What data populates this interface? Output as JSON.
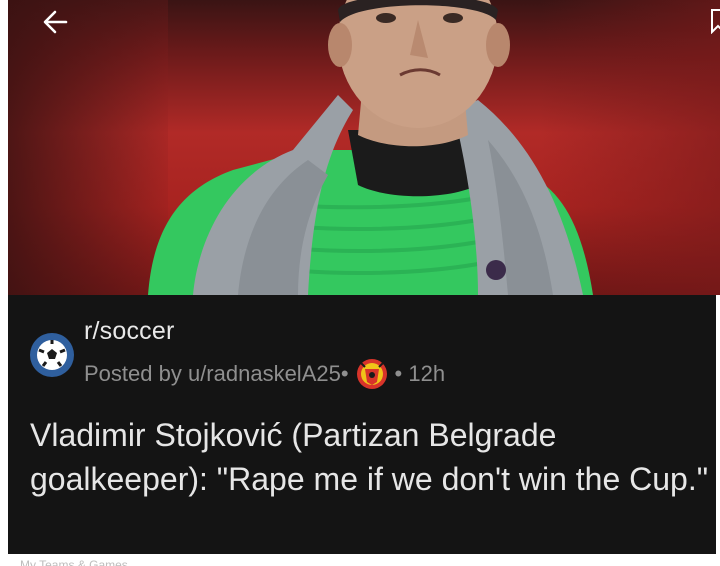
{
  "post": {
    "community": "r/soccer",
    "posted_by_prefix": "Posted by u/radnaskelA25",
    "separator": "•",
    "time": "• 12h",
    "title": "Vladimir Stojković (Partizan Belgrade goalkeeper): \"Rape me if we don't win the Cup.\""
  },
  "icons": {
    "back": "back-arrow-icon",
    "bookmark": "bookmark-icon",
    "avatar": "soccer-ball-icon",
    "flair": "manchester-united-crest-icon"
  },
  "bottom_strip": {
    "partial_text": "My Teams & Games"
  },
  "colors": {
    "background": "#141414",
    "title": "#e6e6e6",
    "meta": "#8f8f8f",
    "avatar": "#2f5f9e",
    "hero_red": "#b12a27",
    "jersey_green": "#3fcf6a"
  }
}
